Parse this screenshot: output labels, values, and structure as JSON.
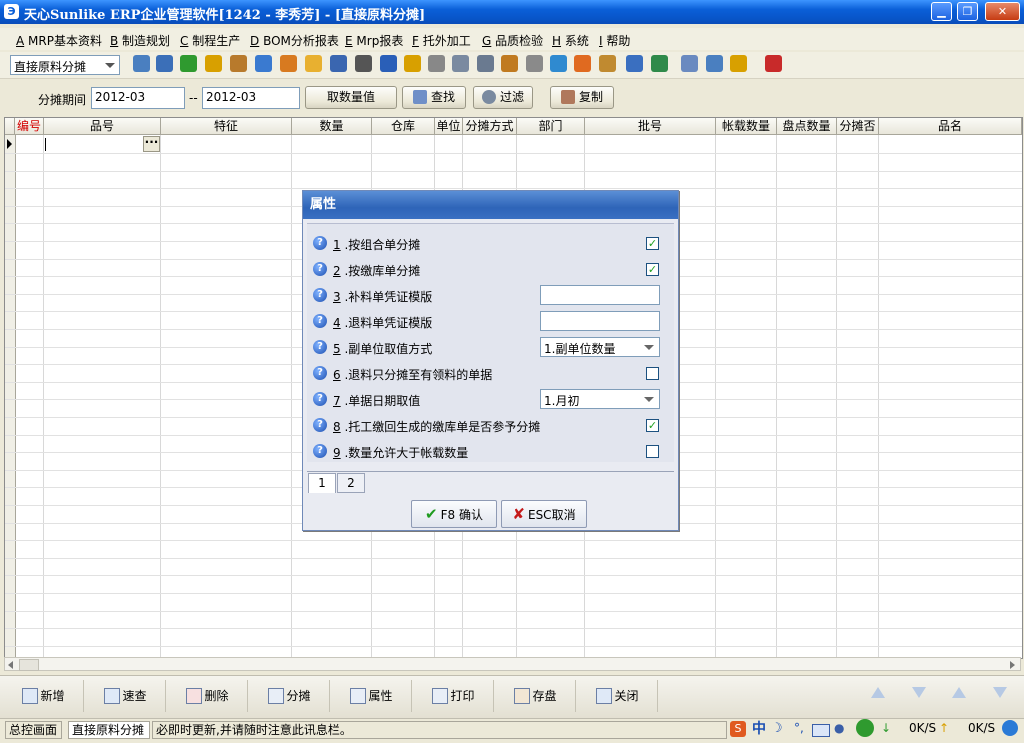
{
  "window": {
    "app_icon": "Э",
    "title": "天心Sunlike ERP企业管理软件[1242 - 李秀芳] - [直接原料分摊]",
    "min_glyph": "▁",
    "max_glyph": "❐",
    "close_glyph": "✕"
  },
  "menu": [
    {
      "key": "A",
      "label": " MRP基本资料"
    },
    {
      "key": "B",
      "label": " 制造规划"
    },
    {
      "key": "C",
      "label": " 制程生产"
    },
    {
      "key": "D",
      "label": " BOM分析报表"
    },
    {
      "key": "E",
      "label": " Mrp报表"
    },
    {
      "key": "F",
      "label": " 托外加工"
    },
    {
      "key": "G",
      "label": " 品质检验"
    },
    {
      "key": "H",
      "label": " 系统"
    },
    {
      "key": "I",
      "label": " 帮助"
    }
  ],
  "toolbar": {
    "module_select": "直接原料分摊",
    "icons": [
      "tree-icon",
      "monitor-icon",
      "phone-icon",
      "person-icon",
      "briefcase-icon",
      "home-icon",
      "group-icon",
      "mail-icon",
      "card-icon",
      "link-icon",
      "help-icon",
      "dollar-icon",
      "cart-icon",
      "document-icon",
      "calculator-icon",
      "box-icon",
      "copy-icon",
      "check-icon",
      "bell-icon",
      "hierarchy-icon",
      "screen-icon",
      "refresh-icon",
      "window-icon",
      "close-window-icon",
      "tile-icon",
      "exit-icon"
    ]
  },
  "filter": {
    "period_label": "分摊期间",
    "period_from": "2012-03",
    "period_sep": "--",
    "period_to": "2012-03",
    "get_qty_button": "取数量值",
    "find_button": "查找",
    "filter_button": "过滤",
    "copy_button": "复制"
  },
  "grid": {
    "columns": [
      "编号",
      "品号",
      "特征",
      "数量",
      "仓库",
      "单位",
      "分摊方式",
      "部门",
      "批号",
      "帐载数量",
      "盘点数量",
      "分摊否",
      "品名"
    ],
    "ellipsis": "···"
  },
  "dialog": {
    "title": "属性",
    "rows": [
      {
        "num": "1",
        "label": " .按组合单分摊",
        "control": "checkbox",
        "checked": true
      },
      {
        "num": "2",
        "label": " .按缴库单分摊",
        "control": "checkbox",
        "checked": true
      },
      {
        "num": "3",
        "label": " .补料单凭证模版",
        "control": "text",
        "value": ""
      },
      {
        "num": "4",
        "label": " .退料单凭证模版",
        "control": "text",
        "value": ""
      },
      {
        "num": "5",
        "label": " .副单位取值方式",
        "control": "select",
        "value": "1.副单位数量"
      },
      {
        "num": "6",
        "label": " .退料只分摊至有领料的单据",
        "control": "checkbox",
        "checked": false
      },
      {
        "num": "7",
        "label": " .单据日期取值",
        "control": "select",
        "value": "1.月初"
      },
      {
        "num": "8",
        "label": " .托工缴回生成的缴库单是否参予分摊",
        "control": "checkbox",
        "checked": true
      },
      {
        "num": "9",
        "label": " .数量允许大于帐载数量",
        "control": "checkbox",
        "checked": false
      }
    ],
    "tabs": [
      "1",
      "2"
    ],
    "confirm_button": "F8 确认",
    "cancel_button": "ESC取消",
    "check_glyph": "✓",
    "help_glyph": "?"
  },
  "bottom_buttons": [
    {
      "name": "add-button",
      "label": "新增"
    },
    {
      "name": "quick-search-button",
      "label": "速查"
    },
    {
      "name": "delete-button",
      "label": "删除"
    },
    {
      "name": "allocate-button",
      "label": "分摊"
    },
    {
      "name": "properties-button",
      "label": "属性"
    },
    {
      "name": "print-button",
      "label": "打印"
    },
    {
      "name": "save-button",
      "label": "存盘"
    },
    {
      "name": "close-button",
      "label": "关闭"
    }
  ],
  "status": {
    "main_screen_tab": "总控画面",
    "current_tab": "直接原料分摊",
    "message": "必即时更新,并请随时注意此讯息栏。",
    "ime": "中",
    "down_speed": "0K/S",
    "up_speed": "0K/S"
  },
  "colors": {
    "title_bar": "#0a5fd8",
    "dialog_title": "#2e64b8",
    "highlight_header": "#d40000"
  }
}
